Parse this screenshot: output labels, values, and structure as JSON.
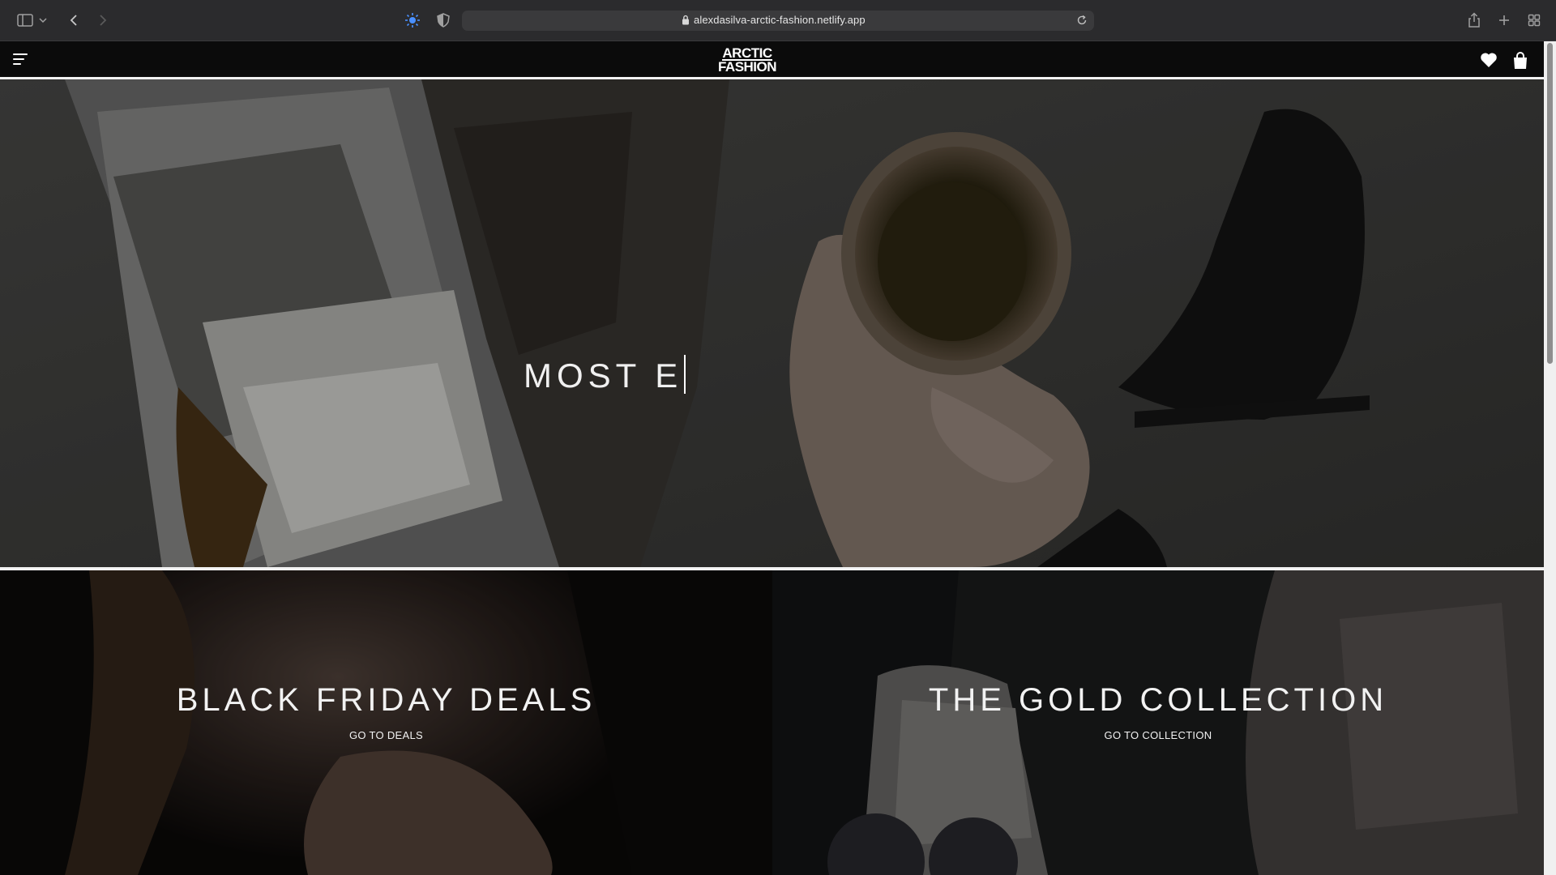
{
  "browser": {
    "url": "alexdasilva-arctic-fashion.netlify.app",
    "icons": [
      "sidebar-icon",
      "chevron-down-icon",
      "back-icon",
      "forward-icon",
      "privacy-icon",
      "shield-icon",
      "lock-icon",
      "reload-icon",
      "share-icon",
      "new-tab-icon",
      "tab-overview-icon"
    ]
  },
  "site": {
    "logo_line1": "ARCTIC",
    "logo_line2": "FASHION",
    "icons": [
      "menu-icon",
      "heart-icon",
      "shopping-bag-icon"
    ]
  },
  "hero": {
    "typed_text": "MOST E"
  },
  "promos": [
    {
      "title": "BLACK FRIDAY DEALS",
      "link": "GO TO DEALS"
    },
    {
      "title": "THE GOLD COLLECTION",
      "link": "GO TO COLLECTION"
    }
  ],
  "colors": {
    "header_bg": "#0b0b0b",
    "chrome_bg": "#2b2b2d",
    "accent": "#4a90ff",
    "text": "#ffffff"
  }
}
